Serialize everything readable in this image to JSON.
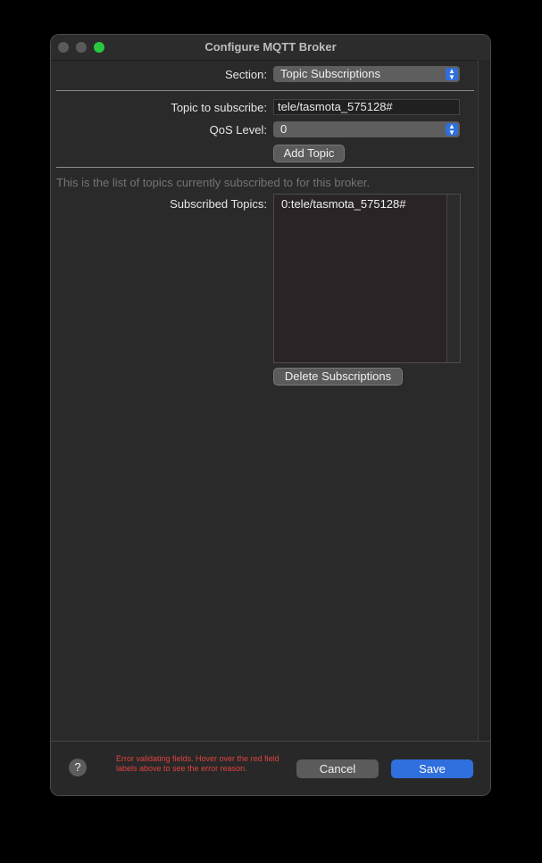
{
  "window": {
    "title": "Configure MQTT Broker"
  },
  "section": {
    "label": "Section:",
    "value": "Topic Subscriptions"
  },
  "topic": {
    "label": "Topic to subscribe:",
    "value": "tele/tasmota_575128#"
  },
  "qos": {
    "label": "QoS Level:",
    "value": "0"
  },
  "add_topic_button": "Add Topic",
  "hint": "This is the list of topics currently subscribed to for this broker.",
  "subscribed": {
    "label": "Subscribed Topics:",
    "items": [
      "0:tele/tasmota_575128#"
    ]
  },
  "delete_button": "Delete Subscriptions",
  "footer": {
    "help": "?",
    "error": "Error validating fields. Hover over the red field labels above to see the error reason.",
    "cancel": "Cancel",
    "save": "Save"
  },
  "colors": {
    "accent": "#2f6fde",
    "error": "#e0433f",
    "maximize": "#28c840"
  }
}
